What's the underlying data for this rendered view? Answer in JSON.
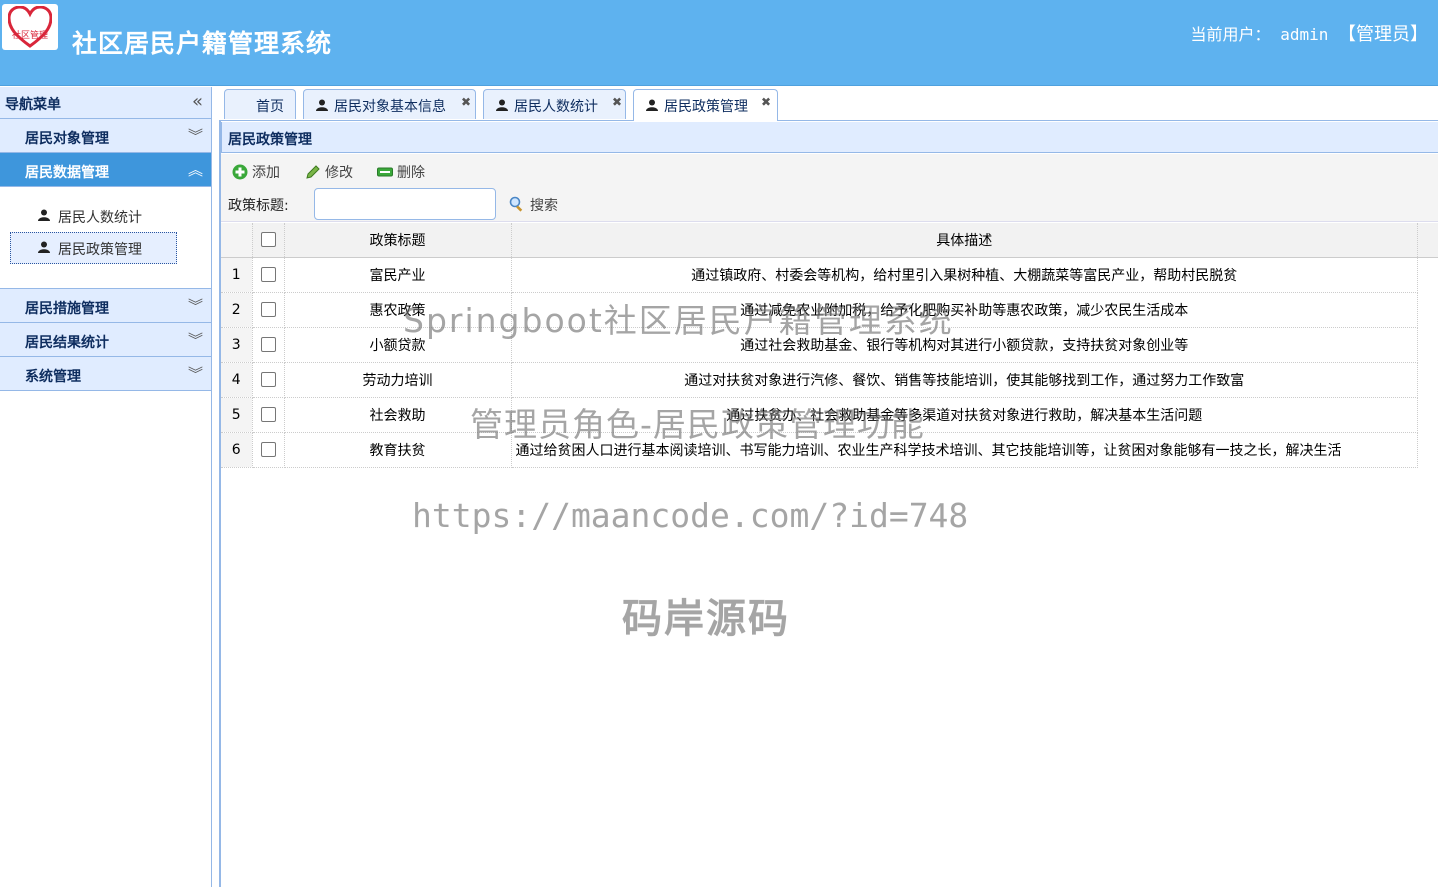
{
  "header": {
    "logo_text": "社区管理",
    "title": "社区居民户籍管理系统",
    "user_label": "当前用户：",
    "user_name": "admin",
    "user_role": "【管理员】"
  },
  "sidebar": {
    "title": "导航菜单",
    "groups": [
      {
        "label": "居民对象管理"
      },
      {
        "label": "居民数据管理"
      },
      {
        "label": "居民措施管理"
      },
      {
        "label": "居民结果统计"
      },
      {
        "label": "系统管理"
      }
    ],
    "sub_items": [
      {
        "label": "居民人数统计"
      },
      {
        "label": "居民政策管理"
      }
    ]
  },
  "tabs": [
    {
      "label": "首页"
    },
    {
      "label": "居民对象基本信息"
    },
    {
      "label": "居民人数统计"
    },
    {
      "label": "居民政策管理"
    }
  ],
  "panel": {
    "title": "居民政策管理"
  },
  "toolbar": {
    "add": "添加",
    "edit": "修改",
    "delete": "删除",
    "search_label": "政策标题:",
    "search_value": "",
    "search_button": "搜索"
  },
  "grid": {
    "headers": {
      "title": "政策标题",
      "desc": "具体描述"
    },
    "rows": [
      {
        "n": "1",
        "title": "富民产业",
        "desc": "通过镇政府、村委会等机构，给村里引入果树种植、大棚蔬菜等富民产业，帮助村民脱贫"
      },
      {
        "n": "2",
        "title": "惠农政策",
        "desc": "通过减免农业附加税，给予化肥购买补助等惠农政策，减少农民生活成本"
      },
      {
        "n": "3",
        "title": "小额贷款",
        "desc": "通过社会救助基金、银行等机构对其进行小额贷款，支持扶贫对象创业等"
      },
      {
        "n": "4",
        "title": "劳动力培训",
        "desc": "通过对扶贫对象进行汽修、餐饮、销售等技能培训，使其能够找到工作，通过努力工作致富"
      },
      {
        "n": "5",
        "title": "社会救助",
        "desc": "通过扶贫办、社会救助基金等多渠道对扶贫对象进行救助，解决基本生活问题"
      },
      {
        "n": "6",
        "title": "教育扶贫",
        "desc": "通过给贫困人口进行基本阅读培训、书写能力培训、农业生产科学技术培训、其它技能培训等，让贫困对象能够有一技之长，解决生活"
      }
    ]
  },
  "watermarks": {
    "line1": "Springboot社区居民户籍管理系统",
    "line2": "管理员角色-居民政策管理功能",
    "line3": "https://maancode.com/?id=748",
    "line4": "码岸源码"
  },
  "colors": {
    "header_bg": "#5eb2ef",
    "active_group": "#3e96dc",
    "panel_bg": "#e0ecff",
    "border": "#95b8e7"
  }
}
